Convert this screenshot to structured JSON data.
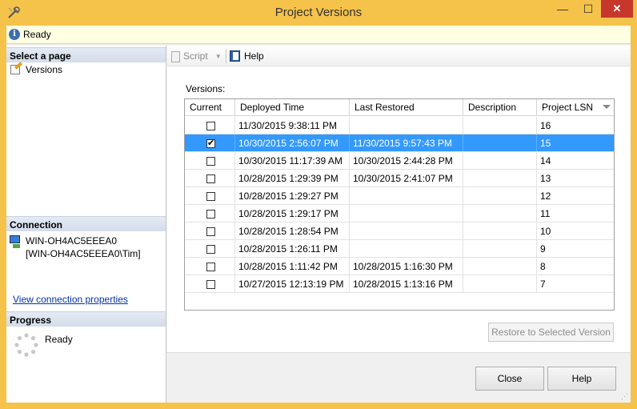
{
  "window": {
    "title": "Project Versions",
    "minimize_glyph": "—",
    "maximize_glyph": "☐",
    "close_glyph": "✕"
  },
  "status": {
    "text": "Ready",
    "icon": "info-icon"
  },
  "left": {
    "select_page_header": "Select a page",
    "pages": [
      {
        "label": "Versions",
        "icon": "page-edit-icon"
      }
    ],
    "connection_header": "Connection",
    "connection_line1": "WIN-OH4AC5EEEA0",
    "connection_line2": "[WIN-OH4AC5EEEA0\\Tim]",
    "connection_link": "View connection properties",
    "progress_header": "Progress",
    "progress_text": "Ready"
  },
  "toolbar": {
    "script_label": "Script",
    "help_label": "Help"
  },
  "versions": {
    "label": "Versions:",
    "columns": [
      "Current",
      "Deployed Time",
      "Last Restored",
      "Description",
      "Project LSN"
    ],
    "rows": [
      {
        "current": false,
        "deployed": "11/30/2015 9:38:11 PM",
        "restored": "",
        "description": "",
        "lsn": "16",
        "selected": false
      },
      {
        "current": true,
        "deployed": "10/30/2015 2:56:07 PM",
        "restored": "11/30/2015 9:57:43 PM",
        "description": "",
        "lsn": "15",
        "selected": true
      },
      {
        "current": false,
        "deployed": "10/30/2015 11:17:39 AM",
        "restored": "10/30/2015 2:44:28 PM",
        "description": "",
        "lsn": "14",
        "selected": false
      },
      {
        "current": false,
        "deployed": "10/28/2015 1:29:39 PM",
        "restored": "10/30/2015 2:41:07 PM",
        "description": "",
        "lsn": "13",
        "selected": false
      },
      {
        "current": false,
        "deployed": "10/28/2015 1:29:27 PM",
        "restored": "",
        "description": "",
        "lsn": "12",
        "selected": false
      },
      {
        "current": false,
        "deployed": "10/28/2015 1:29:17 PM",
        "restored": "",
        "description": "",
        "lsn": "11",
        "selected": false
      },
      {
        "current": false,
        "deployed": "10/28/2015 1:28:54 PM",
        "restored": "",
        "description": "",
        "lsn": "10",
        "selected": false
      },
      {
        "current": false,
        "deployed": "10/28/2015 1:26:11 PM",
        "restored": "",
        "description": "",
        "lsn": "9",
        "selected": false
      },
      {
        "current": false,
        "deployed": "10/28/2015 1:11:42 PM",
        "restored": "10/28/2015 1:16:30 PM",
        "description": "",
        "lsn": "8",
        "selected": false
      },
      {
        "current": false,
        "deployed": "10/27/2015 12:13:19 PM",
        "restored": "10/28/2015 1:13:16 PM",
        "description": "",
        "lsn": "7",
        "selected": false
      }
    ],
    "restore_button": "Restore to Selected Version"
  },
  "buttons": {
    "close": "Close",
    "help": "Help"
  }
}
